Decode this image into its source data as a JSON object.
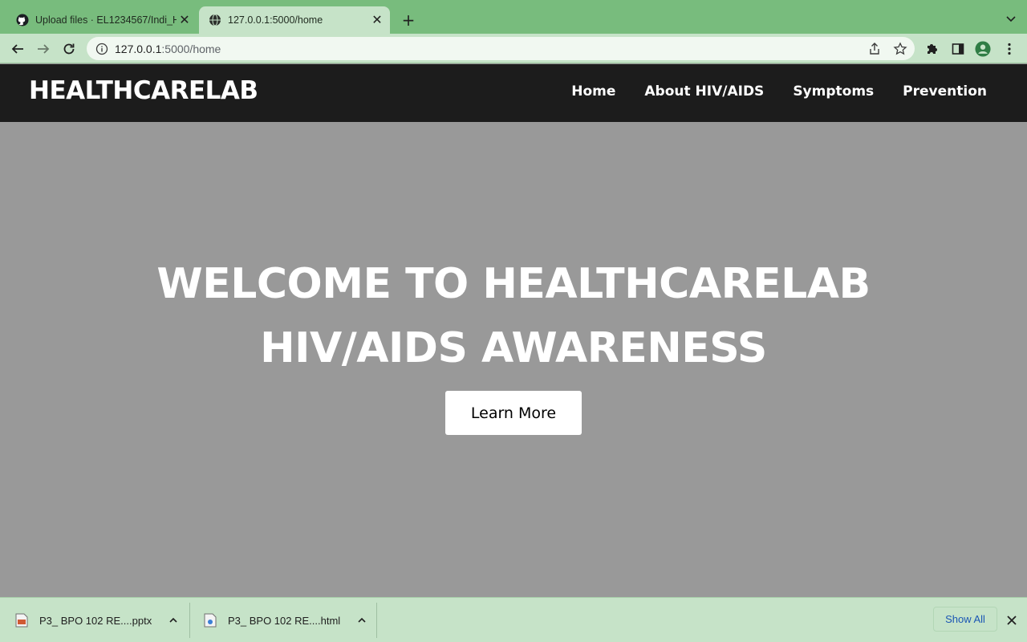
{
  "browser": {
    "tabs": [
      {
        "title": "Upload files · EL1234567/Indi_H",
        "icon": "github-icon",
        "active": false
      },
      {
        "title": "127.0.0.1:5000/home",
        "icon": "globe-icon",
        "active": true
      }
    ],
    "close_glyph": "✕",
    "new_tab_glyph": "+",
    "url_host": "127.0.0.1",
    "url_rest": ":5000/home",
    "colors": {
      "tabstrip": "#78bc7d",
      "toolbar": "#c6e3c8"
    }
  },
  "site": {
    "brand": "HEALTHCARELAB",
    "nav": [
      "Home",
      "About HIV/AIDS",
      "Symptoms",
      "Prevention"
    ],
    "hero": {
      "line1": "WELCOME TO HEALTHCARELAB",
      "line2": "HIV/AIDS AWARENESS",
      "button": "Learn More"
    },
    "colors": {
      "nav_bg": "#1c1c1c",
      "hero_bg": "#999999"
    }
  },
  "downloads": {
    "items": [
      {
        "name": "P3_ BPO 102 RE....pptx",
        "icon": "pptx-file-icon"
      },
      {
        "name": "P3_ BPO 102 RE....html",
        "icon": "html-file-icon"
      }
    ],
    "show_all": "Show All"
  }
}
